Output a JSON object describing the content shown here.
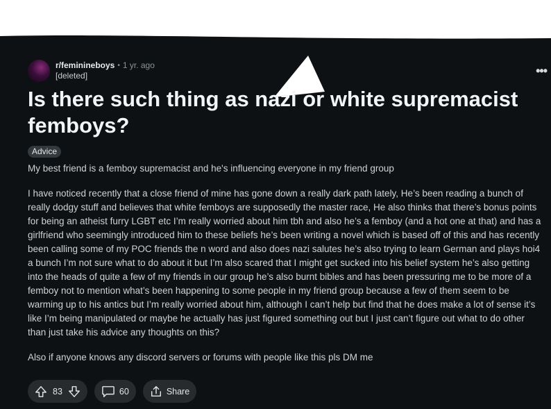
{
  "post": {
    "subreddit": "r/feminineboys",
    "age": "1 yr. ago",
    "author": "[deleted]",
    "title": "Is there such thing as nazi or white supremacist femboys?",
    "flair": "Advice",
    "body_p1": "My best friend is a femboy supremacist and he's influencing everyone in my friend group",
    "body_p2": "I have noticed recently that a close friend of mine has gone down a really dark path lately, He’s been reading a bunch of really dodgy stuff and believes that white femboys are supposedly the master race, He also thinks that there’s bonus points for being an atheist furry LGBT etc I’m really worried about him tbh and also he’s a femboy (and a hot one at that) and has a girlfriend who seemingly introduced him to these beliefs he’s been writing a novel which is based off of this and has recently been calling some of my POC friends the n word and also does nazi salutes he’s also trying to learn German and plays hoi4 a bunch I’m not sure what to do about it but I’m also scared that I might get sucked into his belief system he’s also getting into the heads of quite a few of my friends in our group he’s also burnt bibles and has been pressuring me to be more of a femboy not to mention what’s been happening to some people in my friend group because a few of them seem to be warming up to his antics but I’m really worried about him, although I can’t help but find that he does make a lot of sense it’s like I’m being manipulated or maybe he actually has just figured something out but I just can’t figure out what to do other than just take his advice any thoughts on this?",
    "body_p3": "Also if anyone knows any discord servers or forums with people like this pls DM me",
    "votes": "83",
    "comments": "60",
    "share_label": "Share"
  },
  "colors": {
    "background": "#0e1113",
    "pill": "#272b2e",
    "flair": "#33393d"
  },
  "icons": [
    "more-icon",
    "upvote-icon",
    "downvote-icon",
    "comment-icon",
    "share-icon"
  ]
}
